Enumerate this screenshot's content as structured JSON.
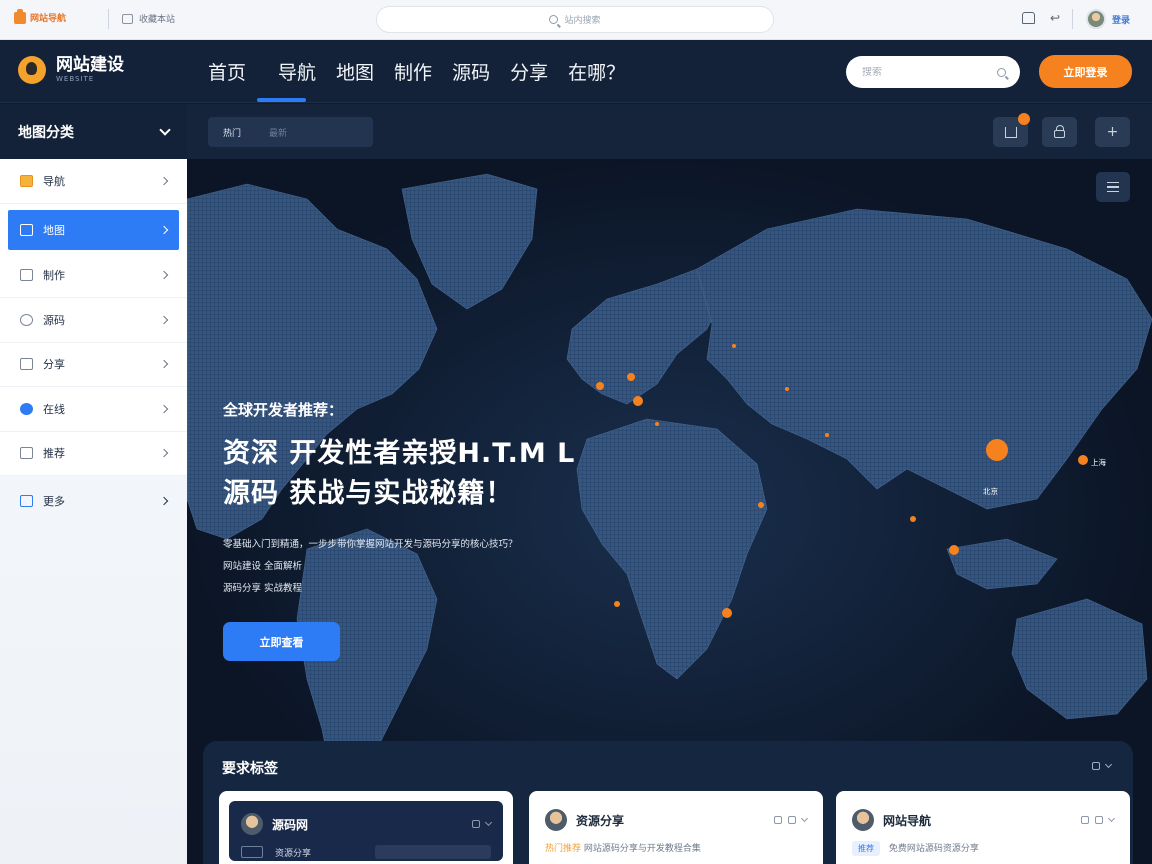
{
  "topbar": {
    "brand": "网站导航",
    "link": "收藏本站",
    "search_placeholder": "站内搜索",
    "user": "登录"
  },
  "header": {
    "logo_title": "网站建设",
    "logo_sub": "WEBSITE",
    "nav": [
      "首页",
      "导航",
      "地图",
      "制作",
      "源码",
      "分享",
      "在哪？"
    ],
    "search_placeholder": "搜索",
    "cta": "立即登录"
  },
  "sidebar": {
    "title": "地图分类",
    "items": [
      {
        "label": "导航",
        "icon": "wallet-icon"
      },
      {
        "label": "地图",
        "icon": "store-icon"
      },
      {
        "label": "制作",
        "icon": "home-icon"
      },
      {
        "label": "源码",
        "icon": "user-icon"
      },
      {
        "label": "分享",
        "icon": "mail-icon"
      },
      {
        "label": "在线",
        "icon": "globe-icon"
      },
      {
        "label": "推荐",
        "icon": "inbox-icon"
      }
    ],
    "extra": "更多"
  },
  "subbar": {
    "tabs": [
      "热门",
      "最新"
    ]
  },
  "hero": {
    "kicker": "全球开发者推荐：",
    "title_line1": "资深 开发性者亲授H.T.M L",
    "title_line2": "源码 获战与实战秘籍！",
    "desc": [
      "零基础入门到精通，一步步带你掌握网站开发与源码分享的核心技巧？",
      "网站建设 全面解析",
      "源码分享 实战教程"
    ],
    "button": "立即查看"
  },
  "map_labels": [
    "北京",
    "上海"
  ],
  "panel": {
    "title": "要求标签",
    "cards": [
      {
        "name": "源码网",
        "sub": "资源分享"
      },
      {
        "name": "资源分享",
        "line_hl": "热门推荐",
        "line": "网站源码分享与开发教程合集"
      },
      {
        "name": "网站导航",
        "tag": "推荐",
        "line": "免费网站源码资源分享"
      }
    ]
  },
  "colors": {
    "accent": "#2e7bf6",
    "orange": "#f5821f",
    "navy": "#132238"
  }
}
